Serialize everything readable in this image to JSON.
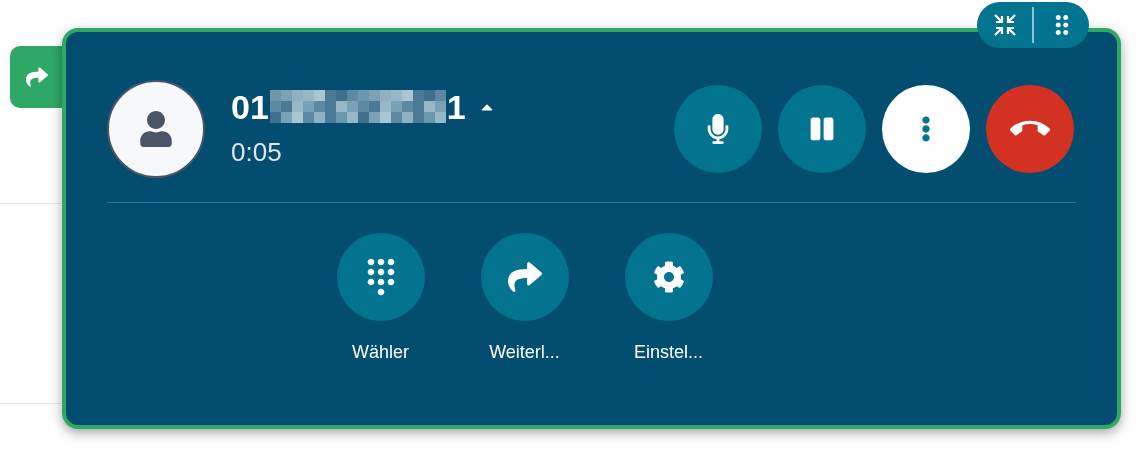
{
  "caller": {
    "number_start": "01",
    "number_end": "1",
    "duration": "0:05"
  },
  "call_actions": [
    {
      "kind": "mute"
    },
    {
      "kind": "hold"
    },
    {
      "kind": "more"
    },
    {
      "kind": "hangup"
    }
  ],
  "quick_actions": [
    {
      "kind": "dialpad",
      "label": "Wähler"
    },
    {
      "kind": "forward",
      "label": "Weiterl..."
    },
    {
      "kind": "settings",
      "label": "Einstel..."
    }
  ]
}
